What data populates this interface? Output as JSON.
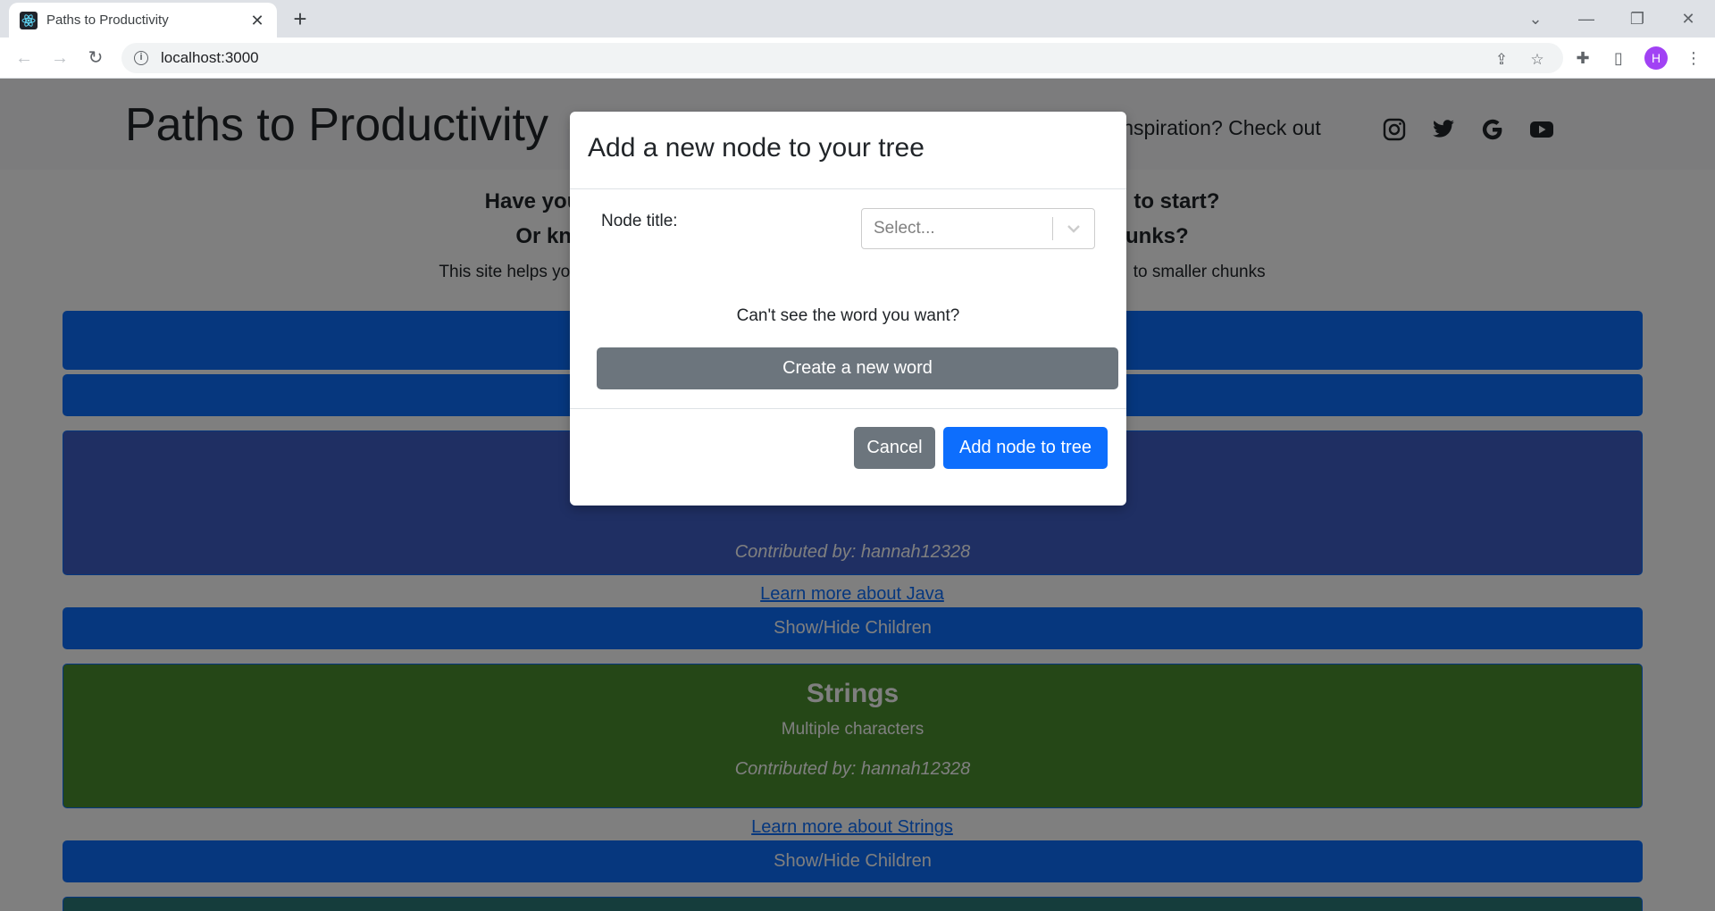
{
  "browser": {
    "tab_title": "Paths to Productivity",
    "url": "localhost:3000",
    "profile_initial": "H"
  },
  "navbar": {
    "brand": "Paths to Productivity",
    "inspiration_text": "ome inspiration? Check out",
    "social_icons": [
      "instagram-icon",
      "twitter-icon",
      "google-icon",
      "youtube-icon"
    ]
  },
  "intro": {
    "line1_left": "Have you",
    "line1_right": "to start?",
    "line2_left": "Or kn",
    "line2_right": "unks?",
    "line3_left": "This site helps you",
    "line3_right": "to smaller chunks"
  },
  "tree": {
    "java_contributor": "Contributed by: hannah12328",
    "java_learn_more": "Learn more about Java",
    "show_hide_1": "Show/Hide Children",
    "strings_title": "Strings",
    "strings_description": "Multiple characters",
    "strings_contributor": "Contributed by: hannah12328",
    "strings_learn_more": "Learn more about Strings",
    "show_hide_2": "Show/Hide Children"
  },
  "modal": {
    "title": "Add a new node to your tree",
    "node_title_label": "Node title:",
    "select_placeholder": "Select...",
    "cant_see_text": "Can't see the word you want?",
    "create_word_label": "Create a new word",
    "cancel_label": "Cancel",
    "add_label": "Add node to tree"
  },
  "colors": {
    "primary": "#0d6efd",
    "secondary": "#6c757d",
    "java_card": "#3f5fc6",
    "strings_card": "#4a8f2f",
    "next_card": "#2a7a78"
  }
}
